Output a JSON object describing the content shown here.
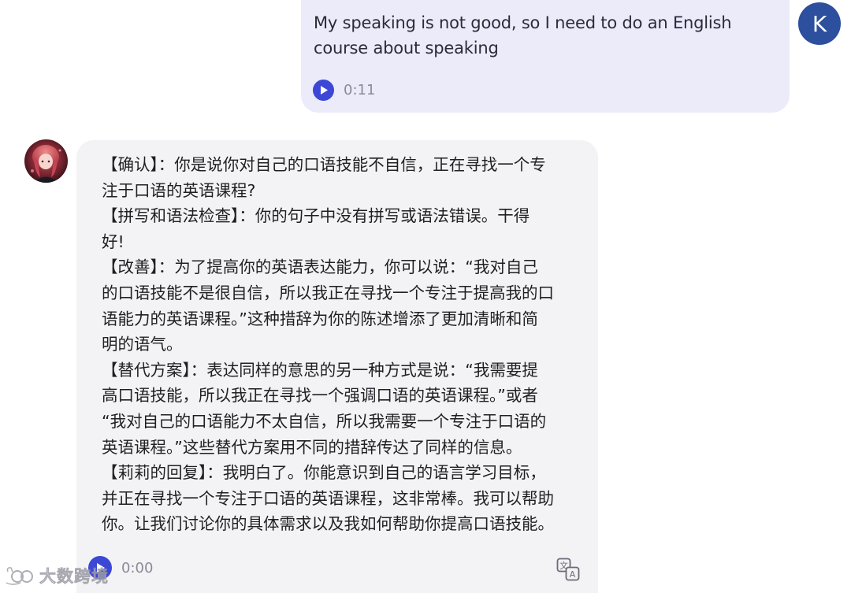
{
  "user_message": {
    "text": "My speaking is not good, so I need to do an English course about speaking",
    "audio_duration": "0:11",
    "avatar_letter": "K",
    "colors": {
      "bubble": "#ebebfa",
      "avatar": "#2c4f9e",
      "play": "#3d47d6"
    }
  },
  "bot_message": {
    "lines": [
      "【确认】：你是说你对自己的口语技能不自信，正在寻找一个专",
      "注于口语的英语课程?",
      "【拼写和语法检查】：你的句子中没有拼写或语法错误。干得",
      "好!",
      "【改善】：为了提高你的英语表达能力，你可以说：“我对自己",
      "的口语技能不是很自信，所以我正在寻找一个专注于提高我的口",
      "语能力的英语课程。”这种措辞为你的陈述增添了更加清晰和简",
      "明的语气。",
      "【替代方案】：表达同样的意思的另一种方式是说：“我需要提",
      "高口语技能，所以我正在寻找一个强调口语的英语课程。”或者",
      "“我对自己的口语能力不太自信，所以我需要一个专注于口语的",
      "英语课程。”这些替代方案用不同的措辞传达了同样的信息。",
      "【莉莉的回复】：我明白了。你能意识到自己的语言学习目标，",
      "并正在寻找一个专注于口语的英语课程，这非常棒。我可以帮助",
      "你。让我们讨论你的具体需求以及我如何帮助你提高口语技能。"
    ],
    "audio_duration": "0:00",
    "colors": {
      "bubble": "#f3f3f5",
      "play": "#3d47d6"
    }
  },
  "watermark": {
    "text": "大数跨境"
  },
  "icons": [
    "play-icon",
    "translate-icon",
    "bot-avatar-image",
    "watermark-logo-icon"
  ]
}
